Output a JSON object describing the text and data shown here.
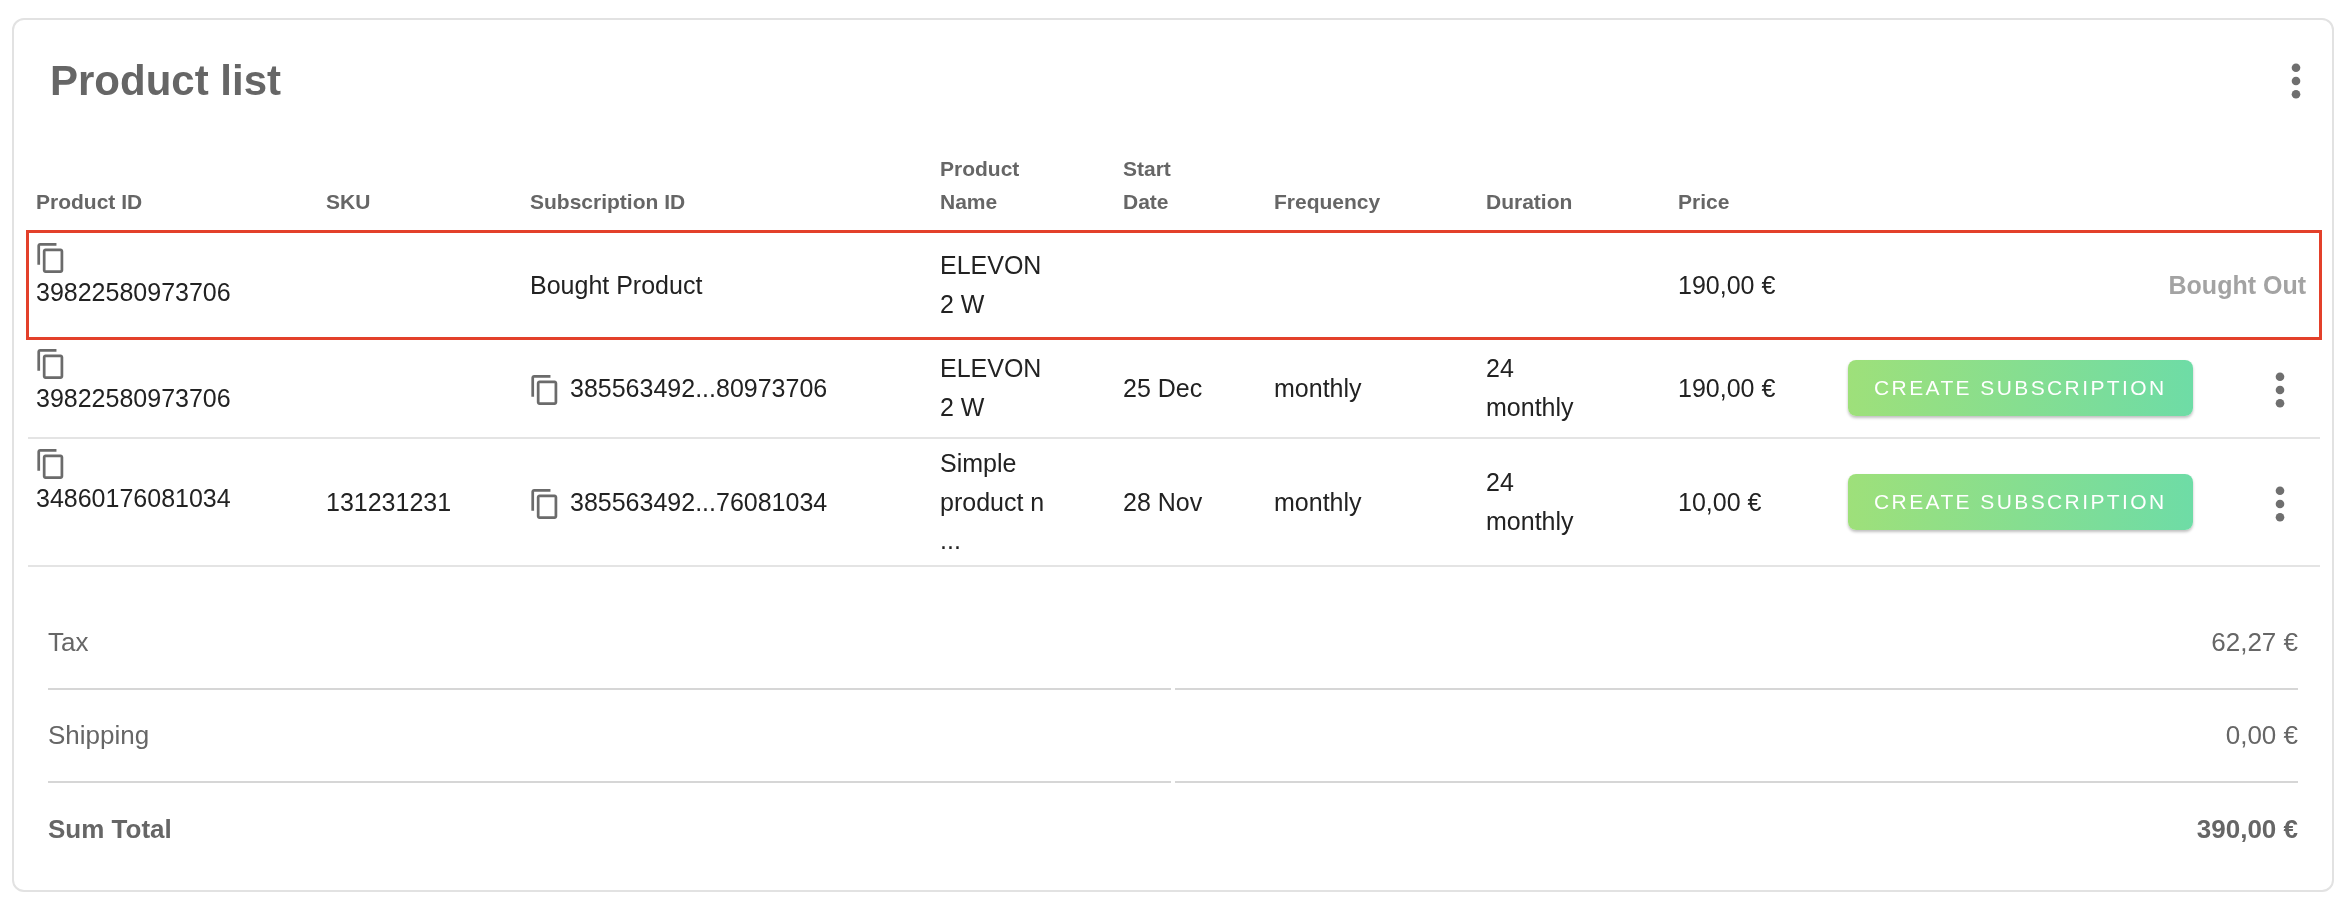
{
  "card": {
    "title": "Product list"
  },
  "table": {
    "columns": [
      "Product ID",
      "SKU",
      "Subscription ID",
      "Product\nName",
      "Start\nDate",
      "Frequency",
      "Duration",
      "Price"
    ],
    "rows": [
      {
        "kind": "bought",
        "highlighted": true,
        "product_id": "39822580973706",
        "subscription": "Bought Product",
        "product_name": "ELEVON\n2 W",
        "price": "190,00 €",
        "status": "Bought Out"
      },
      {
        "kind": "subscription",
        "highlighted": false,
        "product_id": "39822580973706",
        "subscription": "385563492...80973706",
        "product_name": "ELEVON\n2 W",
        "start_date": "25 Dec",
        "frequency": "monthly",
        "duration": "24\nmonthly",
        "price": "190,00 €",
        "action": "CREATE SUBSCRIPTION"
      },
      {
        "kind": "subscription",
        "highlighted": false,
        "product_id": "34860176081034",
        "sku": "131231231",
        "subscription": "385563492...76081034",
        "product_name": "Simple\nproduct n\n...",
        "start_date": "28 Nov",
        "frequency": "monthly",
        "duration": "24\nmonthly",
        "price": "10,00 €",
        "action": "CREATE SUBSCRIPTION"
      }
    ]
  },
  "summary": [
    {
      "kind": "line",
      "label": "Tax",
      "value": "62,27 €"
    },
    {
      "kind": "line",
      "label": "Shipping",
      "value": "0,00 €"
    },
    {
      "kind": "total",
      "label": "Sum Total",
      "value": "390,00 €"
    }
  ]
}
